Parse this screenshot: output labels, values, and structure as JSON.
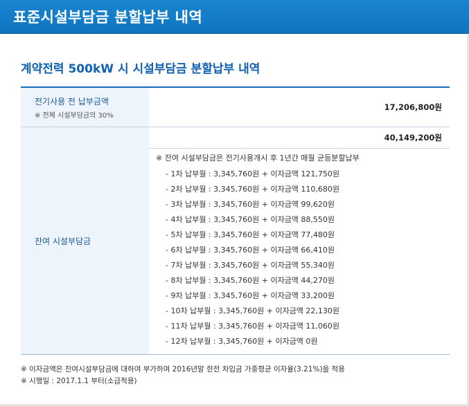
{
  "page": {
    "title": "표준시설부담금 분할납부 내역",
    "subtitle": "계약전력 500kW 시 시설부담금 분할납부 내역"
  },
  "table": {
    "row1": {
      "label": "전기사용 전 납부금액",
      "note": "※ 전체 시설부담금의 30%",
      "amount": "17,206,800원"
    },
    "row2": {
      "label": "잔여 시설부담금",
      "amount": "40,149,200원",
      "desc_head": "※ 잔여 시설부담금은 전기사용개시 후 1년간 매월 균등분할납부",
      "installments": [
        "- 1차 납부월 : 3,345,760원 + 이자금액 121,750원",
        "- 2차 납부월 : 3,345,760원 + 이자금액 110,680원",
        "- 3차 납부월 : 3,345,760원 + 이자금액 99,620원",
        "- 4차 납부월 : 3,345,760원 + 이자금액 88,550원",
        "- 5차 납부월 : 3,345,760원 + 이자금액 77,480원",
        "- 6차 납부월 : 3,345,760원 + 이자금액 66,410원",
        "- 7차 납부월 : 3,345,760원 + 이자금액 55,340원",
        "- 8차 납부월 : 3,345,760원 + 이자금액 44,270원",
        "- 9차 납부월 : 3,345,760원 + 이자금액 33,200원",
        "- 10차 납부월 : 3,345,760원 + 이자금액 22,130원",
        "- 11차 납부월 : 3,345,760원 + 이자금액 11,060원",
        "- 12차 납부월 : 3,345,760원 + 이자금액 0원"
      ]
    }
  },
  "footer": {
    "note1": "※ 이자금액은 잔여시설부담금에 대하여 부가하며 2016년말 한전 차입금 가중평균 이자율(3.21%)을 적용",
    "note2": "※ 시행일 : 2017.1.1 부터(소급적용)"
  },
  "colors": {
    "banner": "#1a85d0",
    "title_text": "#1060b0",
    "header_bg": "#eef4fb"
  }
}
